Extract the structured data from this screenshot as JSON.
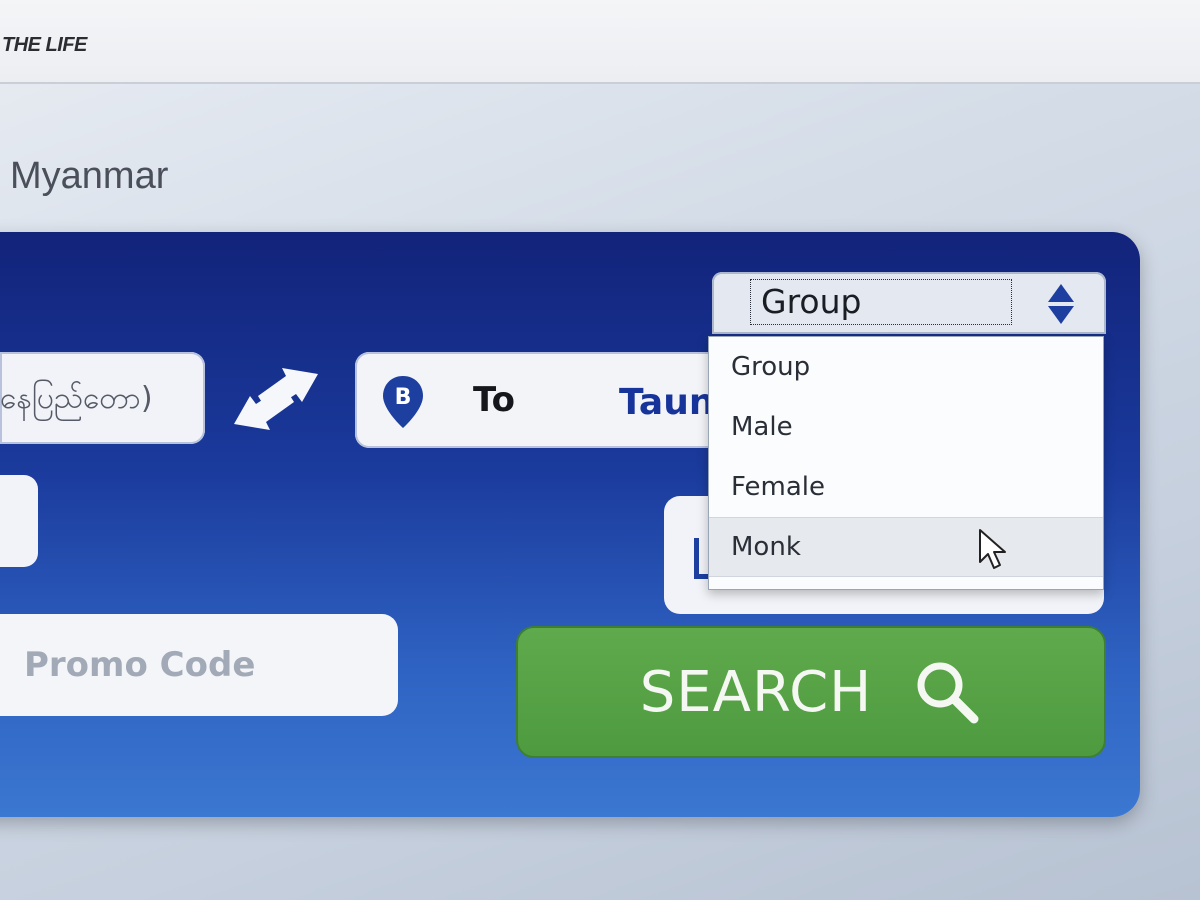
{
  "header": {
    "brand": "THE LIFE",
    "country": "Myanmar"
  },
  "search_form": {
    "from_value": "(နေပြည်တော",
    "to_label": "To",
    "to_value": "Taunggyi",
    "to_pin_letter": "B",
    "promo_placeholder": "Promo Code",
    "search_label": "SEARCH",
    "passenger_select": {
      "selected": "Group",
      "options": [
        "Group",
        "Male",
        "Female",
        "Monk"
      ],
      "highlighted_option": "Monk"
    }
  },
  "colors": {
    "panel": "#1a3a9c",
    "search_button": "#56a346",
    "to_value": "#17349a",
    "pin": "#1c3fa0"
  },
  "icons": {
    "swap": "swap-arrows-icon",
    "pin": "map-pin-icon",
    "search": "search-icon",
    "select": "select-updown-icon",
    "cursor": "mouse-pointer-icon"
  }
}
